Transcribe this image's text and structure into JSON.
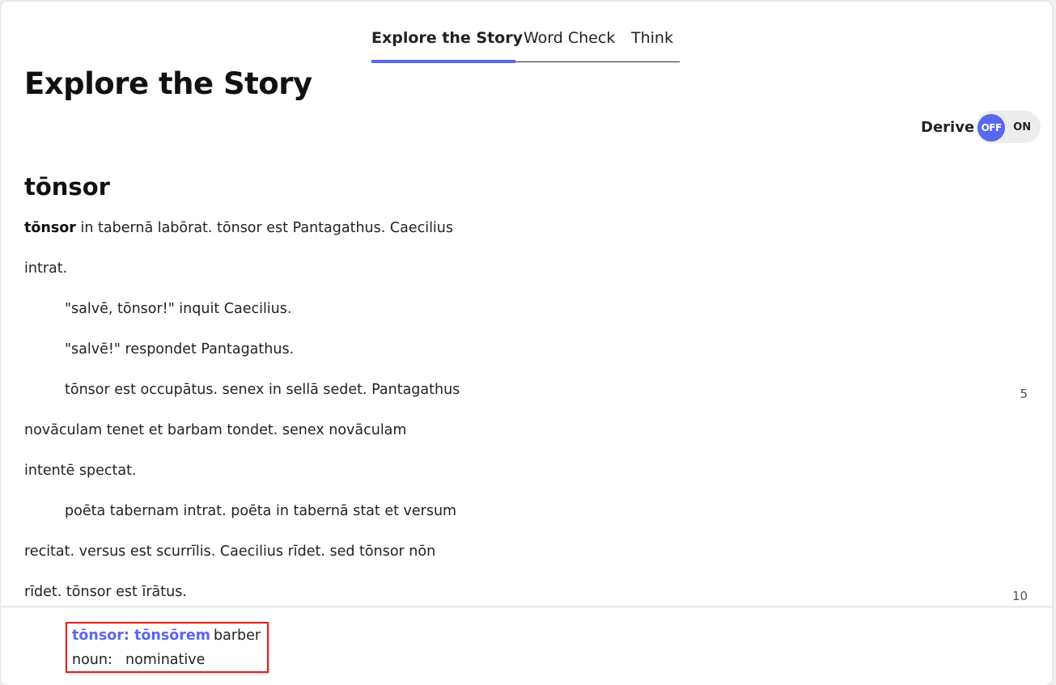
{
  "tabs": [
    {
      "label": "Explore the Story",
      "active": true
    },
    {
      "label": "Word Check",
      "active": false
    },
    {
      "label": "Think",
      "active": false
    }
  ],
  "page": {
    "title": "Explore the Story"
  },
  "derive": {
    "label": "Derive",
    "off_label": "OFF",
    "on_label": "ON",
    "state": "off"
  },
  "story": {
    "title": "tōnsor",
    "first_word": "tōnsor",
    "lines": [
      " in tabernā labōrat. tōnsor est Pantagathus. Caecilius",
      "intrat.",
      "\"salvē, tōnsor!\" inquit Caecilius.",
      "\"salvē!\" respondet Pantagathus.",
      "tōnsor est occupātus. senex in sellā sedet. Pantagathus",
      "novāculam tenet et barbam tondet. senex novāculam",
      "intentē spectat.",
      "poēta tabernam intrat. poēta in tabernā stat et versum",
      "recitat. versus est scurrīlis. Caecilius rīdet. sed tōnsor nōn",
      "rīdet. tōnsor est īrātus."
    ],
    "line_numbers": [
      "5",
      "10"
    ]
  },
  "gloss": {
    "headword": "tōnsor: tōnsōrem",
    "meaning": "barber",
    "pos": "noun:",
    "case": "nominative"
  },
  "colors": {
    "accent": "#5b67ee",
    "highlight_border": "#e02020"
  }
}
